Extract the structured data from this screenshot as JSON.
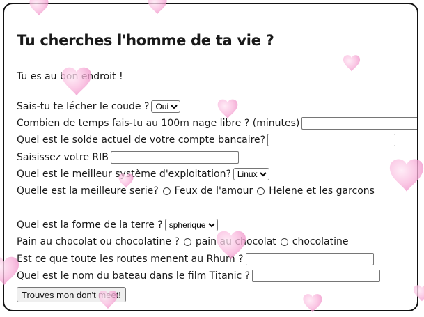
{
  "title": "Tu cherches l'homme de ta vie ?",
  "intro": "Tu es au bon endroit !",
  "q1": {
    "label": "Sais-tu te lécher le coude ?",
    "selected": "Oui"
  },
  "q2": {
    "label": "Combien de temps fais-tu au 100m nage libre ? (minutes)",
    "value": ""
  },
  "q3": {
    "label": "Quel est le solde actuel de votre compte bancaire?",
    "value": ""
  },
  "q4": {
    "label": "Saisissez votre RIB",
    "value": ""
  },
  "q5": {
    "label": "Quel est le meilleur système d'exploitation?",
    "selected": "Linux"
  },
  "q6": {
    "label": "Quelle est la meilleure serie?",
    "options": [
      "Feux de l'amour",
      "Helene et les garcons"
    ]
  },
  "q7": {
    "label": "Quel est la forme de la terre ?",
    "selected": "spherique"
  },
  "q8": {
    "label": "Pain au chocolat ou chocolatine ?",
    "options": [
      "pain au chocolat",
      "chocolatine"
    ]
  },
  "q9": {
    "label": "Est ce que toute les routes menent au Rhum ?",
    "value": ""
  },
  "q10": {
    "label": "Quel est le nom du bateau dans le film Titanic ?",
    "value": ""
  },
  "submit_label": "Trouves mon don't meet!",
  "colors": {
    "heart": "#f7a8d6",
    "border": "#111111"
  }
}
